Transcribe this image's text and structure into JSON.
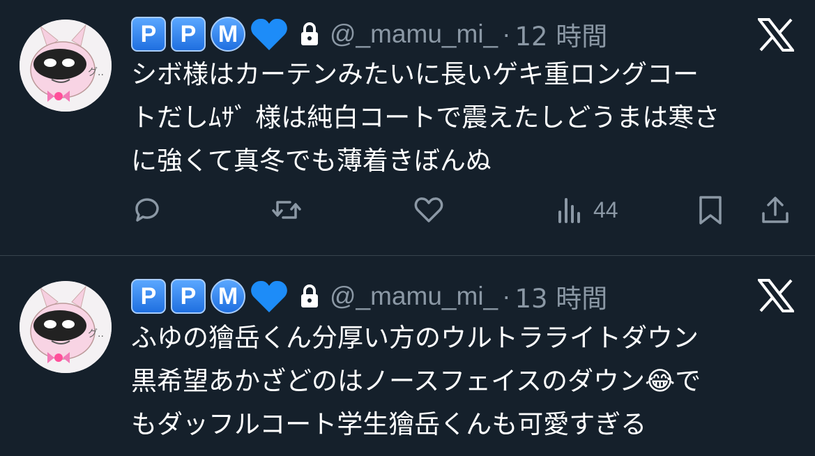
{
  "colors": {
    "background": "#15202b",
    "text": "#ffffff",
    "secondary_text": "#8b98a5",
    "divider": "#38444d",
    "badge_blue": "#1f6fe0",
    "heart_blue": "#1d8cf8"
  },
  "tweets": [
    {
      "badges": [
        "P",
        "P",
        "M"
      ],
      "handle": "@_mamu_mi_",
      "dot": "·",
      "time": "12 時間",
      "lines": [
        "シボ様はカーテンみたいに長いゲキ重ロングコー",
        "トだしﾑｻﾞ 様は純白コートで震えたしどうまは寒さ",
        "に強くて真冬でも薄着きぼんぬ"
      ],
      "views": "44",
      "icons": [
        "reply-icon",
        "retweet-icon",
        "like-icon",
        "views-icon",
        "bookmark-icon",
        "share-icon"
      ]
    },
    {
      "badges": [
        "P",
        "P",
        "M"
      ],
      "handle": "@_mamu_mi_",
      "dot": "·",
      "time": "13 時間",
      "lines": [
        "ふゆの獪岳くん分厚い方のウルトラライトダウン",
        "黒希望あかざどのはノースフェイスのダウン😂で",
        "もダッフルコート学生獪岳くんも可愛すぎる"
      ]
    }
  ]
}
